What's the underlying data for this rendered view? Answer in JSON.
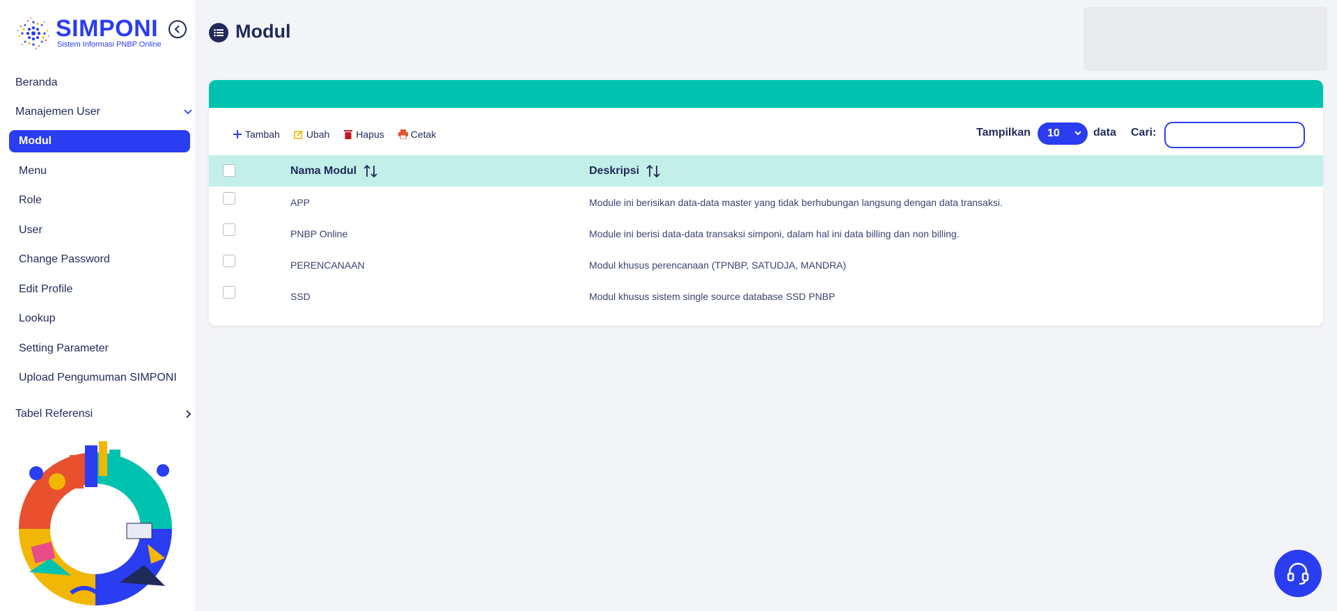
{
  "brand": {
    "title": "SIMPONI",
    "subtitle": "Sistem Informasi PNBP Online"
  },
  "sidebar": {
    "items": [
      {
        "label": "Beranda"
      },
      {
        "label": "Manajemen User"
      },
      {
        "label": "Modul"
      },
      {
        "label": "Menu"
      },
      {
        "label": "Role"
      },
      {
        "label": "User"
      },
      {
        "label": "Change Password"
      },
      {
        "label": "Edit Profile"
      },
      {
        "label": "Lookup"
      },
      {
        "label": "Setting Parameter"
      },
      {
        "label": "Upload Pengumuman SIMPONI"
      },
      {
        "label": "Tabel Referensi"
      }
    ],
    "active": "Modul"
  },
  "page": {
    "title": "Modul"
  },
  "toolbar": {
    "add_label": "Tambah",
    "edit_label": "Ubah",
    "delete_label": "Hapus",
    "print_label": "Cetak"
  },
  "table_controls": {
    "show_label": "Tampilkan",
    "page_length": "10",
    "data_label": "data",
    "search_label": "Cari:",
    "search_value": ""
  },
  "table": {
    "columns": [
      "Nama Modul",
      "Deskripsi"
    ],
    "rows": [
      {
        "name": "APP",
        "description": "Module ini berisikan data-data master yang tidak berhubungan langsung dengan data transaksi."
      },
      {
        "name": "PNBP Online",
        "description": "Module ini berisi data-data transaksi simponi, dalam hal ini data billing dan non billing."
      },
      {
        "name": "PERENCANAAN",
        "description": "Modul khusus perencanaan (TPNBP, SATUDJA, MANDRA)"
      },
      {
        "name": "SSD",
        "description": "Modul khusus sistem single source database SSD PNBP"
      }
    ]
  },
  "colors": {
    "primary": "#2a3df0",
    "header_teal": "#00c2ae",
    "thead_bg": "#c3efe9",
    "navy": "#1f2a5a"
  }
}
